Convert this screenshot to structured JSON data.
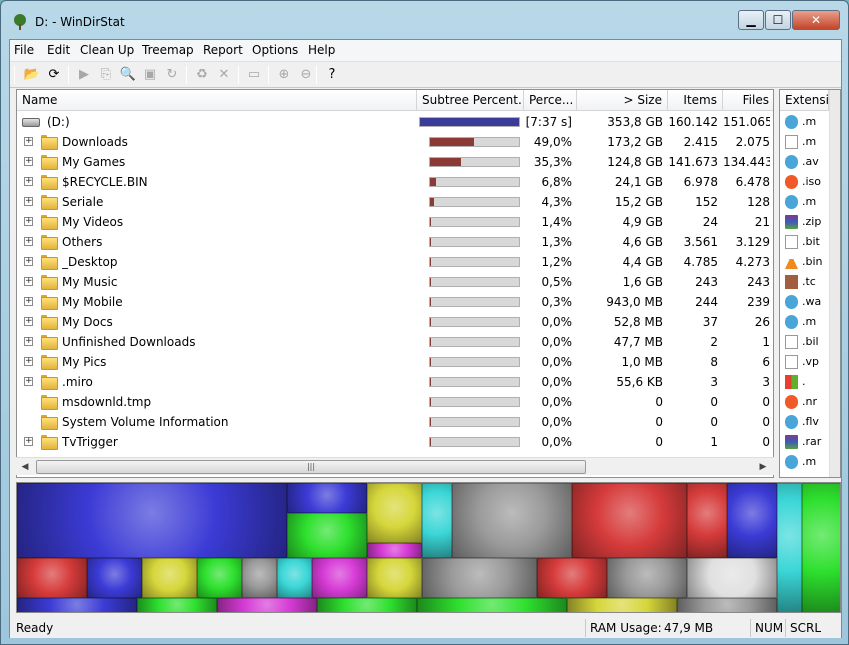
{
  "window": {
    "title": "D: - WinDirStat"
  },
  "menu": [
    "File",
    "Edit",
    "Clean Up",
    "Treemap",
    "Report",
    "Options",
    "Help"
  ],
  "toolbar": [
    {
      "name": "open-icon",
      "glyph": "📂",
      "enabled": true
    },
    {
      "name": "refresh-icon",
      "glyph": "⟳",
      "enabled": true
    },
    {
      "name": "expand-icon",
      "glyph": "▶",
      "enabled": false
    },
    {
      "name": "copy-path-icon",
      "glyph": "⎘",
      "enabled": false
    },
    {
      "name": "explorer-icon",
      "glyph": "🔍",
      "enabled": false
    },
    {
      "name": "command-prompt-icon",
      "glyph": "▣",
      "enabled": false
    },
    {
      "name": "refresh-selected-icon",
      "glyph": "↻",
      "enabled": false
    },
    {
      "name": "recycle-icon",
      "glyph": "♻",
      "enabled": false
    },
    {
      "name": "delete-icon",
      "glyph": "✕",
      "enabled": false
    },
    {
      "name": "properties-icon",
      "glyph": "▭",
      "enabled": false
    },
    {
      "name": "zoom-in-icon",
      "glyph": "⊕",
      "enabled": false
    },
    {
      "name": "zoom-out-icon",
      "glyph": "⊖",
      "enabled": false
    },
    {
      "name": "help-icon",
      "glyph": "?",
      "enabled": true
    }
  ],
  "columns": {
    "name": "Name",
    "subtree": "Subtree Percent...",
    "percent": "Perce...",
    "size": "> Size",
    "items": "Items",
    "files": "Files"
  },
  "rows": [
    {
      "name": "(D:)",
      "type": "drive",
      "fraction": 1.0,
      "percent": "[7:37 s]",
      "size": "353,8 GB",
      "items": "160.142",
      "files": "151.065",
      "expandable": false
    },
    {
      "name": "Downloads",
      "type": "folder",
      "fraction": 0.49,
      "percent": "49,0%",
      "size": "173,2 GB",
      "items": "2.415",
      "files": "2.075",
      "expandable": true
    },
    {
      "name": "My Games",
      "type": "folder",
      "fraction": 0.353,
      "percent": "35,3%",
      "size": "124,8 GB",
      "items": "141.673",
      "files": "134.443",
      "expandable": true
    },
    {
      "name": "$RECYCLE.BIN",
      "type": "folder",
      "fraction": 0.068,
      "percent": "6,8%",
      "size": "24,1 GB",
      "items": "6.978",
      "files": "6.478",
      "expandable": true
    },
    {
      "name": "Seriale",
      "type": "folder",
      "fraction": 0.043,
      "percent": "4,3%",
      "size": "15,2 GB",
      "items": "152",
      "files": "128",
      "expandable": true
    },
    {
      "name": "My Videos",
      "type": "folder",
      "fraction": 0.014,
      "percent": "1,4%",
      "size": "4,9 GB",
      "items": "24",
      "files": "21",
      "expandable": true
    },
    {
      "name": "Others",
      "type": "folder",
      "fraction": 0.013,
      "percent": "1,3%",
      "size": "4,6 GB",
      "items": "3.561",
      "files": "3.129",
      "expandable": true
    },
    {
      "name": "_Desktop",
      "type": "folder",
      "fraction": 0.012,
      "percent": "1,2%",
      "size": "4,4 GB",
      "items": "4.785",
      "files": "4.273",
      "expandable": true
    },
    {
      "name": "My Music",
      "type": "folder",
      "fraction": 0.005,
      "percent": "0,5%",
      "size": "1,6 GB",
      "items": "243",
      "files": "243",
      "expandable": true
    },
    {
      "name": "My Mobile",
      "type": "folder",
      "fraction": 0.003,
      "percent": "0,3%",
      "size": "943,0 MB",
      "items": "244",
      "files": "239",
      "expandable": true
    },
    {
      "name": "My Docs",
      "type": "folder",
      "fraction": 0.0,
      "percent": "0,0%",
      "size": "52,8 MB",
      "items": "37",
      "files": "26",
      "expandable": true
    },
    {
      "name": "Unfinished Downloads",
      "type": "folder",
      "fraction": 0.0,
      "percent": "0,0%",
      "size": "47,7 MB",
      "items": "2",
      "files": "1",
      "expandable": true
    },
    {
      "name": "My Pics",
      "type": "folder",
      "fraction": 0.0,
      "percent": "0,0%",
      "size": "1,0 MB",
      "items": "8",
      "files": "6",
      "expandable": true
    },
    {
      "name": ".miro",
      "type": "folder",
      "fraction": 0.0,
      "percent": "0,0%",
      "size": "55,6 KB",
      "items": "3",
      "files": "3",
      "expandable": true
    },
    {
      "name": "msdownld.tmp",
      "type": "folder",
      "fraction": 0.0,
      "percent": "0,0%",
      "size": "0",
      "items": "0",
      "files": "0",
      "expandable": false
    },
    {
      "name": "System Volume Information",
      "type": "folder",
      "fraction": 0.0,
      "percent": "0,0%",
      "size": "0",
      "items": "0",
      "files": "0",
      "expandable": false
    },
    {
      "name": "TvTrigger",
      "type": "folder",
      "fraction": 0.0,
      "percent": "0,0%",
      "size": "0",
      "items": "1",
      "files": "0",
      "expandable": true
    }
  ],
  "extensions": {
    "header": "Extensi",
    "items": [
      {
        "label": ".m",
        "icon": "media"
      },
      {
        "label": ".m",
        "icon": "doc"
      },
      {
        "label": ".av",
        "icon": "media"
      },
      {
        "label": ".iso",
        "icon": "warn"
      },
      {
        "label": ".m",
        "icon": "media"
      },
      {
        "label": ".zip",
        "icon": "zip"
      },
      {
        "label": ".bit",
        "icon": "doc"
      },
      {
        "label": ".bin",
        "icon": "vlc"
      },
      {
        "label": ".tc",
        "icon": "tc"
      },
      {
        "label": ".wa",
        "icon": "media"
      },
      {
        "label": ".m",
        "icon": "media"
      },
      {
        "label": ".bil",
        "icon": "doc"
      },
      {
        "label": ".vp",
        "icon": "doc"
      },
      {
        "label": ".",
        "icon": "win"
      },
      {
        "label": ".nr",
        "icon": "warn"
      },
      {
        "label": ".flv",
        "icon": "media"
      },
      {
        "label": ".rar",
        "icon": "zip"
      },
      {
        "label": ".m",
        "icon": "media"
      }
    ]
  },
  "status": {
    "left": "Ready",
    "ram_label": "RAM Usage:",
    "ram_value": "47,9 MB",
    "num": "NUM",
    "scrl": "SCRL"
  },
  "colors": {
    "bar": "#8b3a36",
    "drive_bar": "#3b3b9a",
    "treemap": [
      "#3b3bd6",
      "#2ee02e",
      "#d63b3b",
      "#d6d63b",
      "#3bd6d6",
      "#d63bd6",
      "#9a9a9a",
      "#e0e0e0"
    ]
  }
}
